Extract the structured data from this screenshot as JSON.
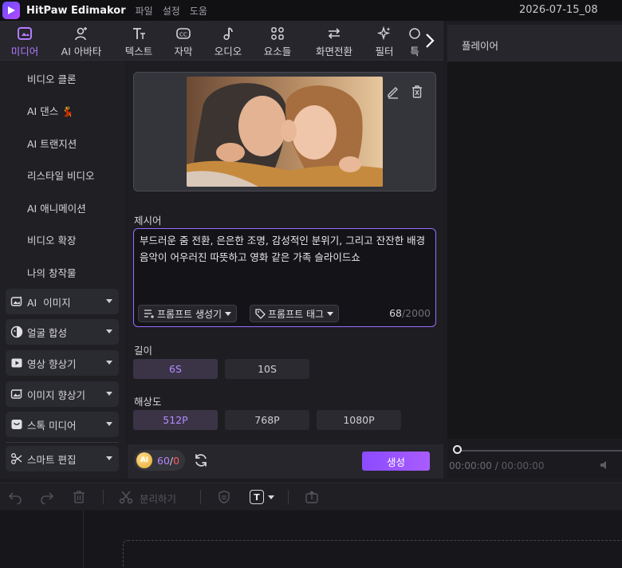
{
  "app": {
    "title": "HitPaw Edimakor",
    "menu": [
      "파일",
      "설정",
      "도움"
    ],
    "project_name": "2026-07-15_08"
  },
  "toolbar": {
    "tabs": [
      {
        "label": "미디어",
        "icon": "media-icon",
        "active": true
      },
      {
        "label": "AI 아바타",
        "icon": "ai-avatar-icon"
      },
      {
        "label": "텍스트",
        "icon": "text-icon"
      },
      {
        "label": "자막",
        "icon": "subtitle-icon"
      },
      {
        "label": "오디오",
        "icon": "music-note-icon"
      },
      {
        "label": "요소들",
        "icon": "elements-icon"
      },
      {
        "label": "화면전환",
        "icon": "transition-icon"
      },
      {
        "label": "필터",
        "icon": "filter-sparkle-icon"
      },
      {
        "label": "특",
        "icon": "effects-icon"
      }
    ],
    "next_icon": "chevron-right-icon"
  },
  "sidebar": {
    "links": [
      "비디오 클론",
      "AI 댄스 💃",
      "AI 트랜지션",
      "리스타일 비디오",
      "AI 애니메이션",
      "비디오 확장",
      "나의 창작물"
    ],
    "groups": [
      {
        "label": "AI  이미지",
        "icon": "ai-image-icon"
      },
      {
        "label": "얼굴 합성",
        "icon": "face-swap-icon"
      },
      {
        "label": "영상 향상기",
        "icon": "video-enhance-icon"
      },
      {
        "label": "이미지 향상기",
        "icon": "image-enhance-icon"
      },
      {
        "label": "스톡 미디어",
        "icon": "stock-media-icon"
      },
      {
        "label": "스마트 편집",
        "icon": "smart-edit-icon"
      }
    ]
  },
  "panel": {
    "prompt": {
      "label": "제시어",
      "text": "부드러운 줌 전환, 은은한 조명, 감성적인 분위기, 그리고 잔잔한 배경 음악이 어우러진 따뜻하고 영화 같은 가족 슬라이드쇼",
      "generator_button": "프롬프트 생성기",
      "tag_button": "프롬프트 태그",
      "count": "68",
      "max": "/2000"
    },
    "length": {
      "label": "길이",
      "options": [
        "6S",
        "10S"
      ],
      "selected": "6S"
    },
    "resolution": {
      "label": "해상도",
      "options": [
        "512P",
        "768P",
        "1080P"
      ],
      "selected": "512P"
    },
    "footer": {
      "coin_label": "AI",
      "credits_used": "60",
      "credits_sep": "/",
      "credits_left": "0",
      "generate_label": "생성"
    }
  },
  "player": {
    "title": "플레이어",
    "current_time": "00:00:00",
    "time_sep": " / ",
    "total_time": "00:00:00"
  },
  "timeline": {
    "split_label": "분리하기",
    "text_tool_label": "T"
  },
  "colors": {
    "accent": "#9b6cff",
    "generate": "#8b4bff",
    "credits_left": "#ff5c5c"
  }
}
